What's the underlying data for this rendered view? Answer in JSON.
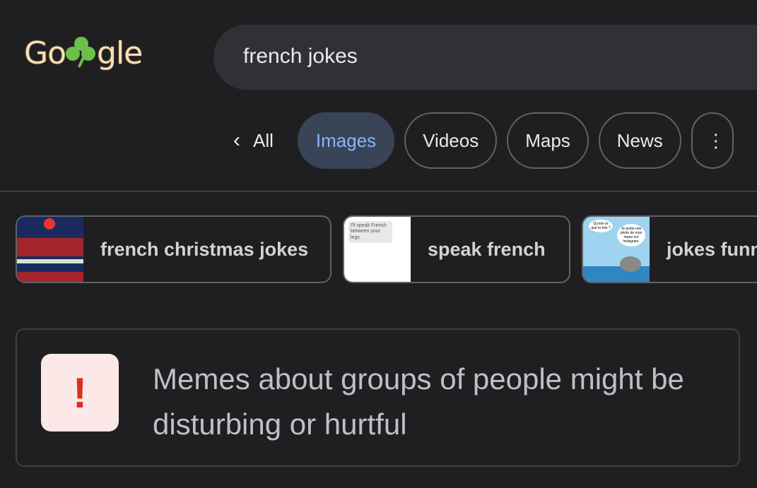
{
  "logo": {
    "text": "Google",
    "icon": "shamrock-doodle"
  },
  "search": {
    "query": "french jokes"
  },
  "tabs": [
    {
      "label": "All",
      "icon": "chevron-left-icon"
    },
    {
      "label": "Images",
      "active": true
    },
    {
      "label": "Videos"
    },
    {
      "label": "Maps"
    },
    {
      "label": "News"
    }
  ],
  "chips": [
    {
      "label": "french christmas jokes"
    },
    {
      "label": "speak french",
      "thumb_text": "I'll speak French between your legs."
    },
    {
      "label": "jokes funn",
      "thumb_text_1": "Qu'est-ce que tu fais ?",
      "thumb_text_2": "Je poste une photo de mon repas sur Instagram."
    }
  ],
  "warning": {
    "icon": "exclamation-icon",
    "text": "Memes about groups of people might be disturbing or hurtful"
  },
  "colors": {
    "background": "#1f1f21",
    "active_tab": "#394457",
    "active_tab_text": "#8ab4f8",
    "warning": "#d93025"
  }
}
